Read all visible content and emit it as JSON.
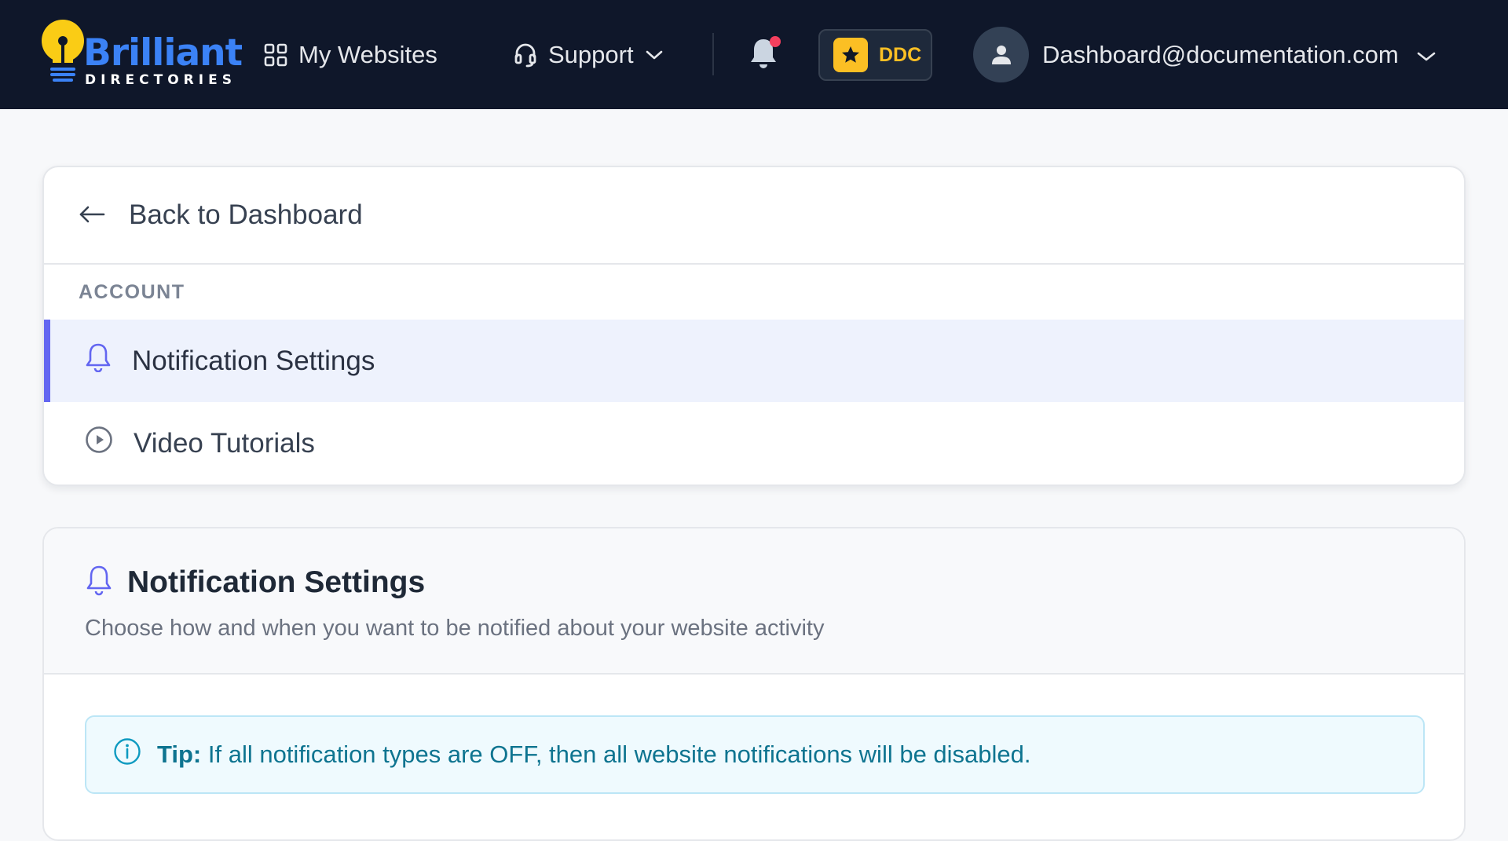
{
  "header": {
    "logo": {
      "word": "Brilliant",
      "sub": "DIRECTORIES"
    },
    "nav": {
      "websites_label": "My Websites",
      "support_label": "Support"
    },
    "notification_badge": true,
    "ddc_label": "DDC",
    "user_email": "Dashboard@documentation.com"
  },
  "menu": {
    "back_label": "Back to Dashboard",
    "section_label": "ACCOUNT",
    "items": [
      {
        "label": "Notification Settings",
        "icon": "bell-icon",
        "active": true
      },
      {
        "label": "Video Tutorials",
        "icon": "play-circle-icon",
        "active": false
      }
    ]
  },
  "settings": {
    "title": "Notification Settings",
    "subtitle": "Choose how and when you want to be notified about your website activity",
    "tip_label": "Tip:",
    "tip_text": "If all notification types are OFF, then all website notifications will be disabled."
  },
  "colors": {
    "topbar": "#0f172a",
    "accent": "#6366f1",
    "logo_blue": "#3b82f6",
    "logo_yellow": "#facc15",
    "ddc_gold": "#fbbf24",
    "tip_text": "#0e7490"
  }
}
